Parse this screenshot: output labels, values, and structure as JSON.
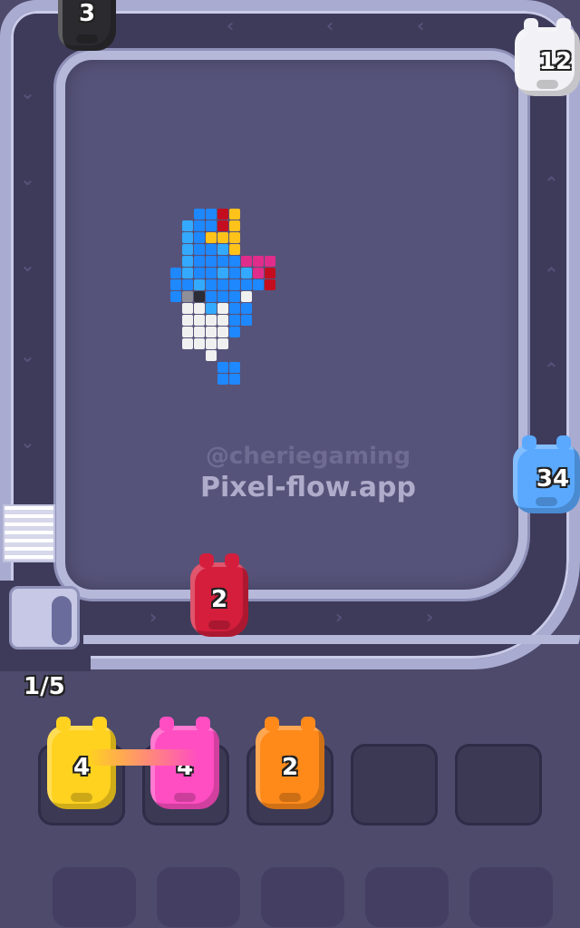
{
  "hud": {
    "slot_counter": "1/5"
  },
  "watermark": {
    "line1": "@cheriegaming",
    "line2": "Pixel-flow.app"
  },
  "track_shooters": [
    {
      "name": "black-shooter",
      "color": "#2b2b2f",
      "count": "3"
    },
    {
      "name": "white-shooter",
      "color": "#f2f2f6",
      "count": "12"
    },
    {
      "name": "blue-shooter",
      "color": "#5aa9ff",
      "count": "34"
    },
    {
      "name": "red-shooter",
      "color": "#d41e3c",
      "count": "2"
    }
  ],
  "slots": [
    {
      "name": "yellow-shooter",
      "color": "#ffd21f",
      "count": "4",
      "linked": true
    },
    {
      "name": "pink-shooter",
      "color": "#ff4ec2",
      "count": "4",
      "linked": true
    },
    {
      "name": "orange-shooter",
      "color": "#ff8a1a",
      "count": "2",
      "linked": false
    },
    {
      "empty": true
    },
    {
      "empty": true
    }
  ],
  "colors": {
    "blue": "#1e88ff",
    "light_blue": "#33aaff",
    "yellow": "#ffc21a",
    "red": "#c40e1f",
    "magenta": "#e02c8a",
    "white": "#f0f0f0",
    "gray": "#8f8f9a",
    "black": "#2c2c36"
  }
}
